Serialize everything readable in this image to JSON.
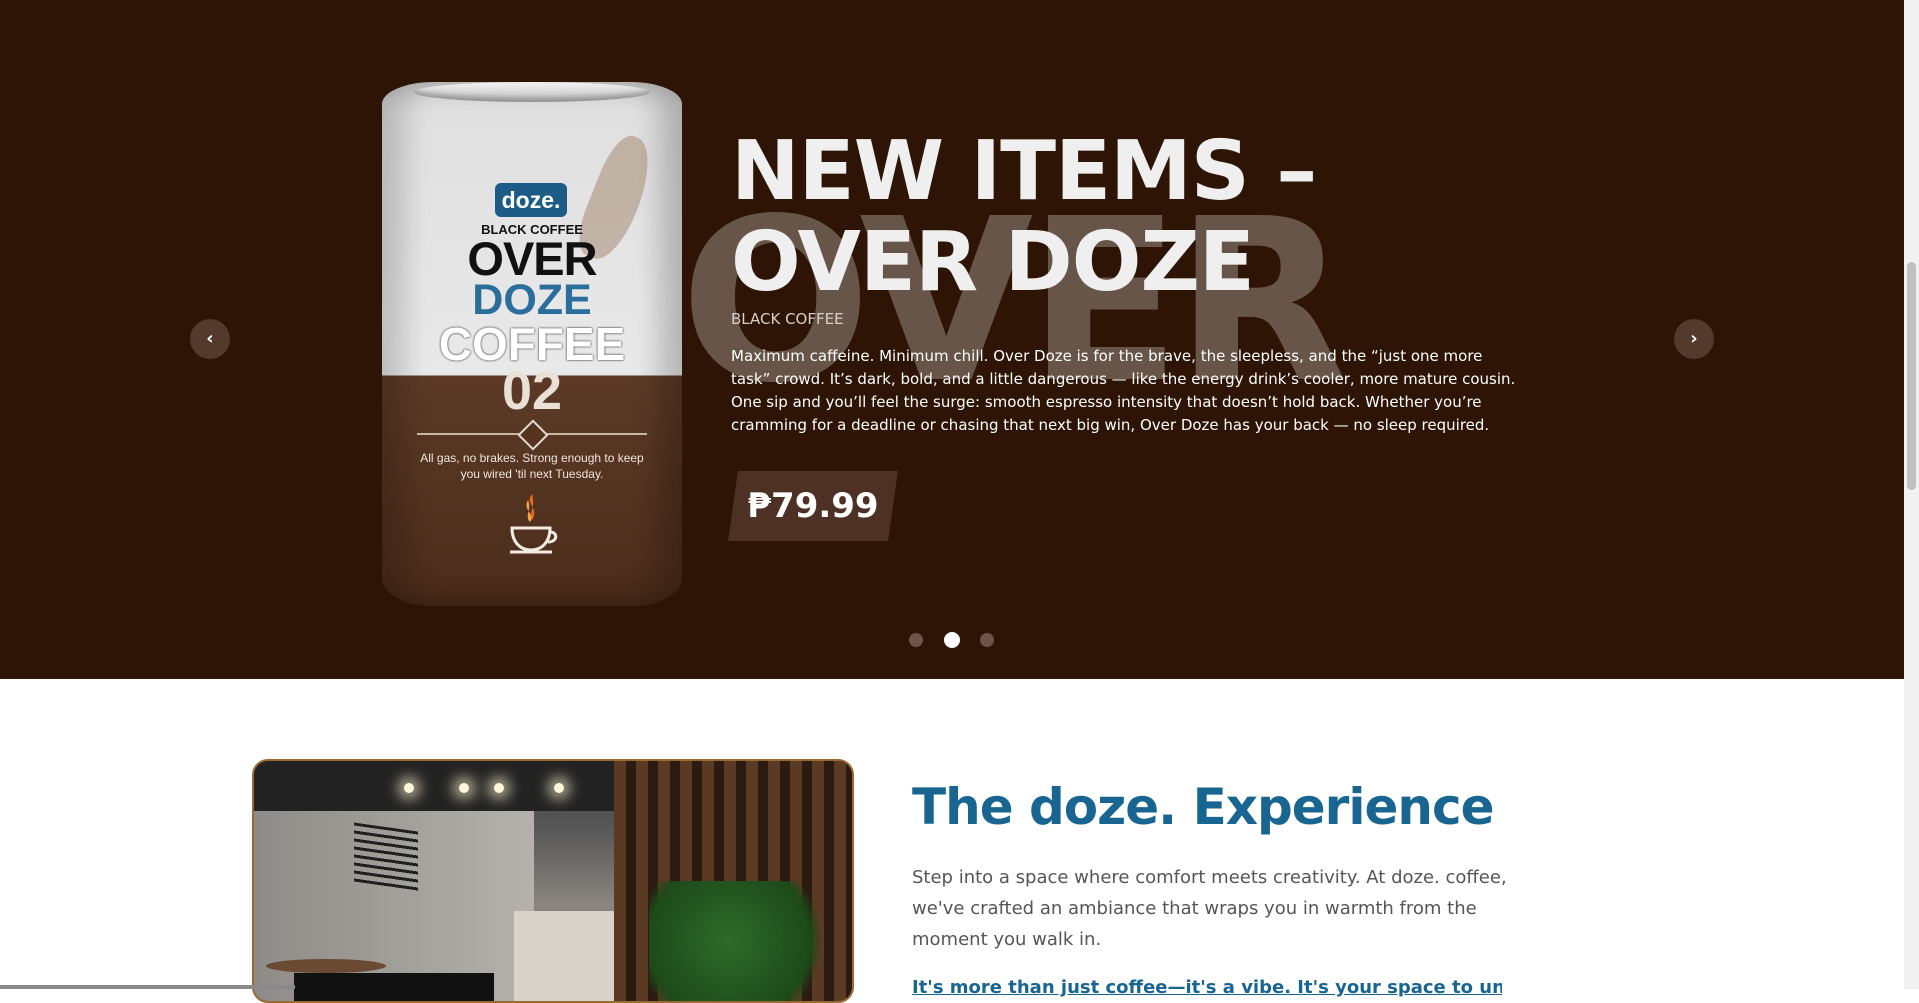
{
  "slider": {
    "can": {
      "logo": "doze.",
      "sub": "BLACK COFFEE",
      "line1": "OVER",
      "line2": "DOZE",
      "line3": "COFFEE",
      "number": "02",
      "tagline": "All gas, no brakes. Strong enough to keep you wired 'til next Tuesday."
    },
    "watermark": "OVER",
    "title_line1": "NEW ITEMS –",
    "title_line2": "OVER DOZE",
    "subtitle": "BLACK COFFEE",
    "description": "Maximum caffeine. Minimum chill. Over Doze is for the brave, the sleepless, and the “just one more task” crowd. It’s dark, bold, and a little dangerous — like the energy drink’s cooler, more mature cousin. One sip and you’ll feel the surge: smooth espresso intensity that doesn’t hold back. Whether you’re cramming for a deadline or chasing that next big win, Over Doze has your back — no sleep required.",
    "price": "₱79.99",
    "prev_icon": "‹",
    "next_icon": "›",
    "slide_count": 3,
    "active_slide": 2
  },
  "experience": {
    "title": "The doze. Experience",
    "text": "Step into a space where comfort meets creativity. At doze. coffee, we've crafted an ambiance that wraps you in warmth from the moment you walk in.",
    "more": "It's more than just coffee—it's a vibe. It's your space to unwind."
  },
  "icons": {
    "prev": "chevron-left-icon",
    "next": "chevron-right-icon",
    "cup": "coffee-cup-icon"
  },
  "colors": {
    "hero_bg": "#2e1404",
    "accent_blue": "#196592",
    "price_bg": "#4c3124"
  }
}
